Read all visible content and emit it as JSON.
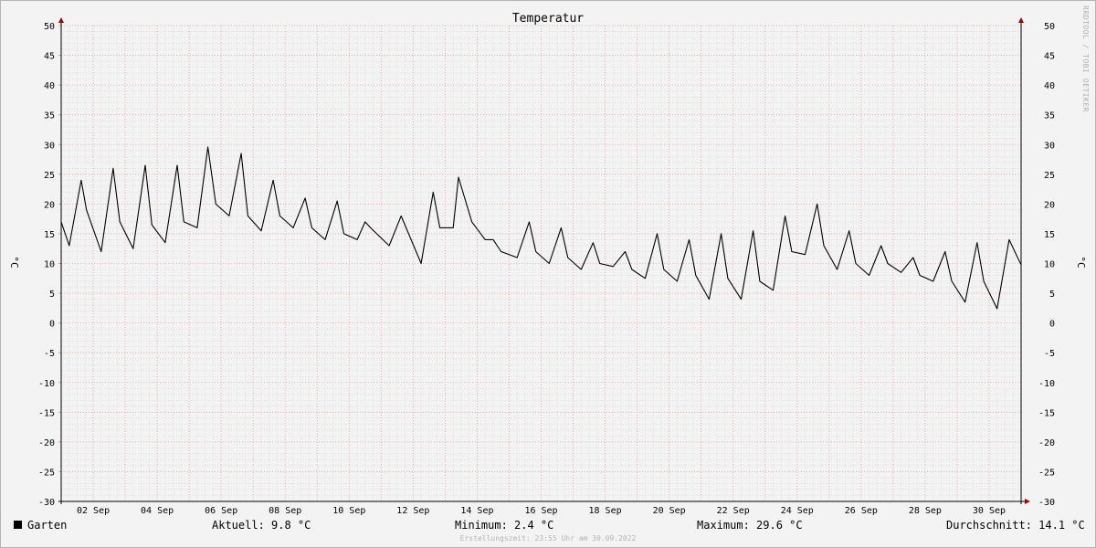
{
  "chart_data": {
    "type": "line",
    "title": "Temperatur",
    "ylabel": "°C",
    "ylim": [
      -30,
      50
    ],
    "yticks": [
      50,
      45,
      40,
      35,
      30,
      25,
      20,
      15,
      10,
      5,
      0,
      -5,
      -10,
      -15,
      -20,
      -25,
      -30
    ],
    "xlim": [
      "2022-09-01",
      "2022-10-01"
    ],
    "xticks": [
      {
        "date": "2022-09-02",
        "label": "02 Sep"
      },
      {
        "date": "2022-09-04",
        "label": "04 Sep"
      },
      {
        "date": "2022-09-06",
        "label": "06 Sep"
      },
      {
        "date": "2022-09-08",
        "label": "08 Sep"
      },
      {
        "date": "2022-09-10",
        "label": "10 Sep"
      },
      {
        "date": "2022-09-12",
        "label": "12 Sep"
      },
      {
        "date": "2022-09-14",
        "label": "14 Sep"
      },
      {
        "date": "2022-09-16",
        "label": "16 Sep"
      },
      {
        "date": "2022-09-18",
        "label": "18 Sep"
      },
      {
        "date": "2022-09-20",
        "label": "20 Sep"
      },
      {
        "date": "2022-09-22",
        "label": "22 Sep"
      },
      {
        "date": "2022-09-24",
        "label": "24 Sep"
      },
      {
        "date": "2022-09-26",
        "label": "26 Sep"
      },
      {
        "date": "2022-09-28",
        "label": "28 Sep"
      },
      {
        "date": "2022-09-30",
        "label": "30 Sep"
      }
    ],
    "grid": true,
    "series": [
      {
        "name": "Garten",
        "color": "#000000",
        "x": [
          "2022-09-01 00:00",
          "2022-09-01 06:00",
          "2022-09-01 15:00",
          "2022-09-01 19:00",
          "2022-09-02 06:00",
          "2022-09-02 15:00",
          "2022-09-02 20:00",
          "2022-09-03 06:00",
          "2022-09-03 15:00",
          "2022-09-03 20:00",
          "2022-09-04 06:00",
          "2022-09-04 15:00",
          "2022-09-04 20:00",
          "2022-09-05 06:00",
          "2022-09-05 14:00",
          "2022-09-05 20:00",
          "2022-09-06 06:00",
          "2022-09-06 15:00",
          "2022-09-06 20:00",
          "2022-09-07 06:00",
          "2022-09-07 15:00",
          "2022-09-07 20:00",
          "2022-09-08 06:00",
          "2022-09-08 15:00",
          "2022-09-08 20:00",
          "2022-09-09 06:00",
          "2022-09-09 15:00",
          "2022-09-09 20:00",
          "2022-09-10 06:00",
          "2022-09-10 12:00",
          "2022-09-10 16:00",
          "2022-09-11 06:00",
          "2022-09-11 15:00",
          "2022-09-12 06:00",
          "2022-09-12 15:00",
          "2022-09-12 20:00",
          "2022-09-13 06:00",
          "2022-09-13 10:00",
          "2022-09-13 20:00",
          "2022-09-14 06:00",
          "2022-09-14 12:00",
          "2022-09-14 18:00",
          "2022-09-15 06:00",
          "2022-09-15 15:00",
          "2022-09-15 20:00",
          "2022-09-16 06:00",
          "2022-09-16 15:00",
          "2022-09-16 20:00",
          "2022-09-17 06:00",
          "2022-09-17 15:00",
          "2022-09-17 20:00",
          "2022-09-18 06:00",
          "2022-09-18 15:00",
          "2022-09-18 20:00",
          "2022-09-19 06:00",
          "2022-09-19 15:00",
          "2022-09-19 20:00",
          "2022-09-20 06:00",
          "2022-09-20 15:00",
          "2022-09-20 20:00",
          "2022-09-21 06:00",
          "2022-09-21 15:00",
          "2022-09-21 20:00",
          "2022-09-22 06:00",
          "2022-09-22 15:00",
          "2022-09-22 20:00",
          "2022-09-23 06:00",
          "2022-09-23 15:00",
          "2022-09-23 20:00",
          "2022-09-24 06:00",
          "2022-09-24 15:00",
          "2022-09-24 20:00",
          "2022-09-25 06:00",
          "2022-09-25 15:00",
          "2022-09-25 20:00",
          "2022-09-26 06:00",
          "2022-09-26 15:00",
          "2022-09-26 20:00",
          "2022-09-27 06:00",
          "2022-09-27 15:00",
          "2022-09-27 20:00",
          "2022-09-28 06:00",
          "2022-09-28 15:00",
          "2022-09-28 20:00",
          "2022-09-29 06:00",
          "2022-09-29 15:00",
          "2022-09-29 20:00",
          "2022-09-30 06:00",
          "2022-09-30 15:00",
          "2022-09-30 23:55"
        ],
        "values": [
          17,
          13,
          24,
          19,
          12,
          26,
          17,
          12.5,
          26.5,
          16.5,
          13.5,
          26.5,
          17,
          16,
          29.6,
          20,
          18,
          28.5,
          18,
          15.5,
          24,
          18,
          16,
          21,
          16,
          14,
          20.5,
          15,
          14,
          17,
          16,
          13,
          18,
          10,
          22,
          16,
          16,
          24.5,
          17,
          14,
          14,
          12,
          11,
          17,
          12,
          10,
          16,
          11,
          9,
          13.5,
          10,
          9.5,
          12,
          9,
          7.5,
          15,
          9,
          7,
          14,
          8,
          4,
          15,
          7.5,
          4,
          15.5,
          7,
          5.5,
          18,
          12,
          11.5,
          20,
          13,
          9,
          15.5,
          10,
          8,
          13,
          10,
          8.5,
          11,
          8,
          7,
          12,
          7,
          3.5,
          13.5,
          7,
          2.4,
          14,
          9.8
        ]
      }
    ],
    "legend": "bottom-left"
  },
  "stats": {
    "series_name": "Garten",
    "aktuell": "Aktuell: 9.8 °C",
    "minimum": "Minimum: 2.4 °C",
    "maximum": "Maximum: 29.6 °C",
    "durchschnitt": "Durchschnitt: 14.1 °C"
  },
  "credit": "RRDTOOL / TOBI OETIKER",
  "footer": "Erstellungszeit: 23:55 Uhr am 30.09.2022",
  "colors": {
    "major_grid": "#e6a0a0",
    "minor_grid": "#cfcfcf",
    "axis": "#000000",
    "arrow": "#a00000",
    "background": "#f3f3f3"
  }
}
